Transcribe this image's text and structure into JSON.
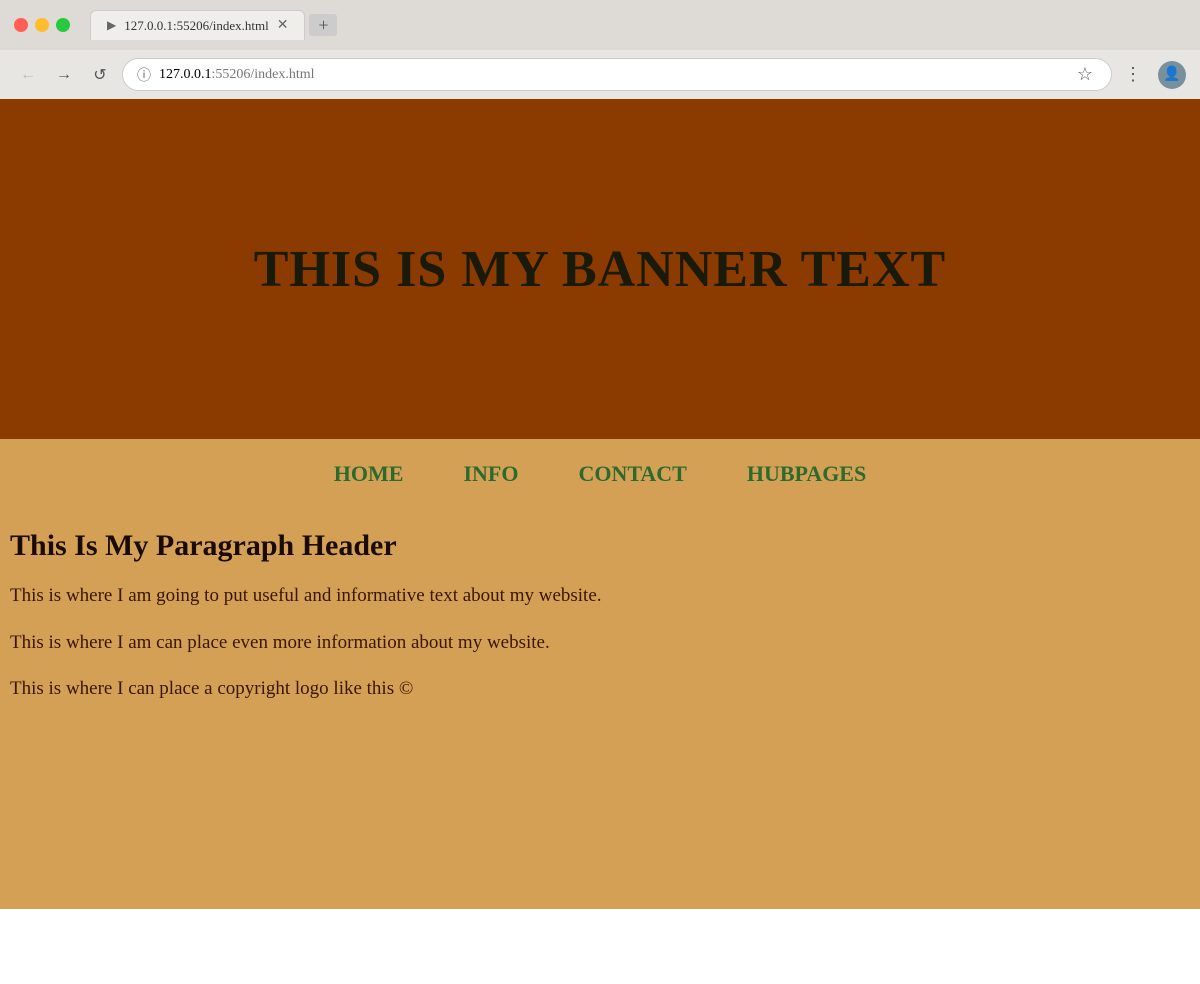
{
  "browser": {
    "url_host": "127.0.0.1",
    "url_path": ":55206/index.html",
    "tab_title": "127.0.0.1:55206/index.html",
    "back_btn": "←",
    "forward_btn": "→",
    "reload_btn": "↺"
  },
  "banner": {
    "text": "THIS IS MY BANNER TEXT"
  },
  "nav": {
    "items": [
      {
        "label": "HOME"
      },
      {
        "label": "INFO"
      },
      {
        "label": "CONTACT"
      },
      {
        "label": "HUBPAGES"
      }
    ]
  },
  "content": {
    "header": "This Is My Paragraph Header",
    "paragraph1": "This is where I am going to put useful and informative text about my website.",
    "paragraph2": "This is where I am can place even more information about my website.",
    "paragraph3": "This is where I can place a copyright logo like this ©"
  },
  "colors": {
    "banner_bg": "#8B3A00",
    "nav_bg": "#d4a056",
    "content_bg": "#d4a056",
    "nav_link_color": "#2d6a2d",
    "banner_text_color": "#1a1a0a",
    "text_color": "#3a1500"
  }
}
